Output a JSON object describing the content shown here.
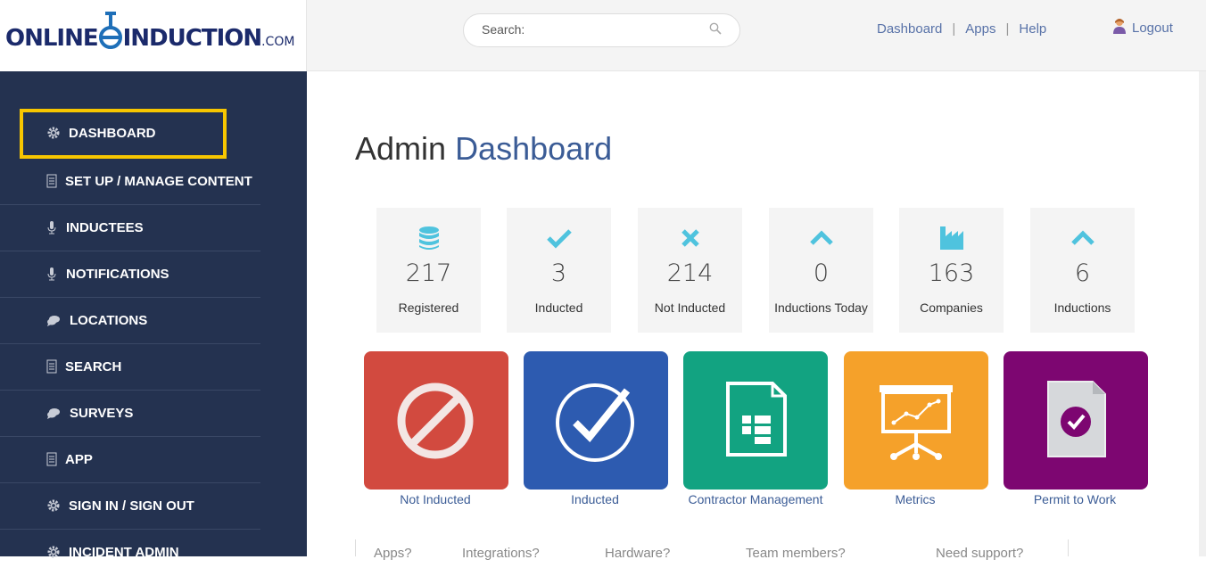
{
  "brand": {
    "logo_left": "ONLINE",
    "logo_right": "INDUCTION",
    "logo_suffix": ".COM"
  },
  "search": {
    "placeholder": "Search:"
  },
  "top_nav": {
    "links": [
      "Dashboard",
      "Apps",
      "Help"
    ],
    "separator": "|",
    "logout_label": "Logout"
  },
  "sidebar": {
    "items": [
      {
        "label": "DASHBOARD",
        "icon": "gear-icon",
        "active": true
      },
      {
        "label": "SET UP / MANAGE CONTENT",
        "icon": "document-icon"
      },
      {
        "label": "INDUCTEES",
        "icon": "microphone-icon"
      },
      {
        "label": "NOTIFICATIONS",
        "icon": "microphone-icon"
      },
      {
        "label": "LOCATIONS",
        "icon": "chat-icon"
      },
      {
        "label": "SEARCH",
        "icon": "document-icon"
      },
      {
        "label": "SURVEYS",
        "icon": "chat-icon"
      },
      {
        "label": "APP",
        "icon": "document-icon"
      },
      {
        "label": "SIGN IN / SIGN OUT",
        "icon": "gear-icon"
      },
      {
        "label": "INCIDENT ADMIN",
        "icon": "gear-icon"
      }
    ],
    "highlight_color": "#f7c600"
  },
  "main": {
    "title_plain": "Admin",
    "title_accent": "Dashboard",
    "stats": [
      {
        "value": "217",
        "label": "Registered",
        "icon": "database-icon"
      },
      {
        "value": "3",
        "label": "Inducted",
        "icon": "checkmark-icon"
      },
      {
        "value": "214",
        "label": "Not Inducted",
        "icon": "x-icon"
      },
      {
        "value": "0",
        "label": "Inductions Today",
        "icon": "chevron-up-icon"
      },
      {
        "value": "163",
        "label": "Companies",
        "icon": "factory-icon"
      },
      {
        "value": "6",
        "label": "Inductions",
        "icon": "chevron-up-icon"
      }
    ],
    "tiles": [
      {
        "label": "Not Inducted",
        "color": "#d24a3f",
        "icon": "prohibited-icon"
      },
      {
        "label": "Inducted",
        "color": "#2d5bb0",
        "icon": "check-circle-icon"
      },
      {
        "label": "Contractor Management",
        "color": "#12a381",
        "icon": "form-document-icon"
      },
      {
        "label": "Metrics",
        "color": "#f5a12a",
        "icon": "presentation-chart-icon"
      },
      {
        "label": "Permit to Work",
        "color": "#7d0671",
        "icon": "permit-document-icon"
      }
    ],
    "footer_links": [
      "Apps?",
      "Integrations?",
      "Hardware?",
      "Team members?",
      "Need support?"
    ]
  },
  "colors": {
    "sidebar_bg": "#243250",
    "accent_blue": "#3b5c96",
    "stat_icon": "#4fc3de"
  }
}
